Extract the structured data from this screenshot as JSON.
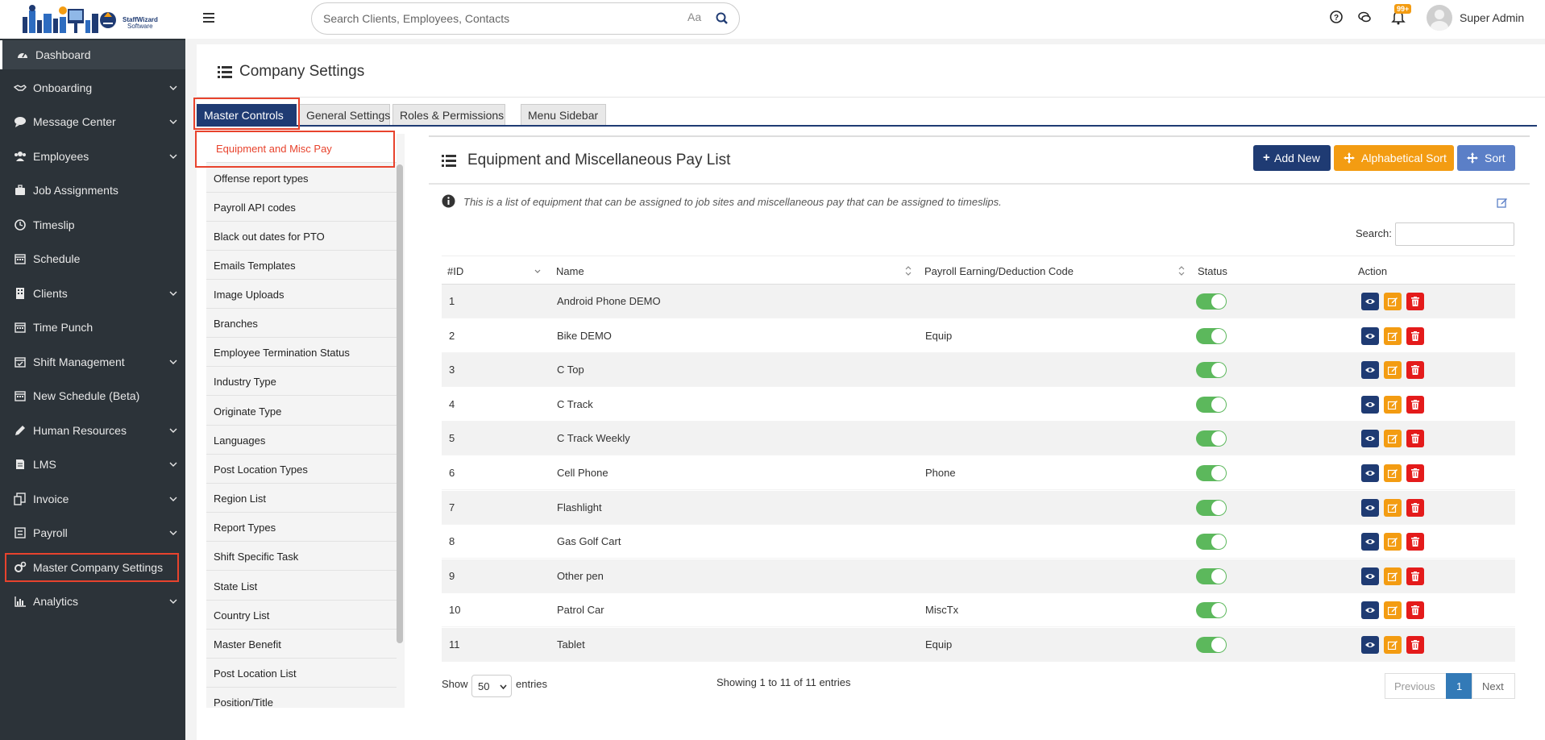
{
  "header": {
    "search_placeholder": "Search Clients, Employees, Contacts",
    "case_toggle": "Aa",
    "notification_count": "99+",
    "user_name": "Super Admin"
  },
  "sidebar": {
    "items": [
      {
        "label": "Dashboard",
        "icon": "dashboard-icon",
        "expandable": false
      },
      {
        "label": "Onboarding",
        "icon": "handshake-icon",
        "expandable": true
      },
      {
        "label": "Message Center",
        "icon": "chat-icon",
        "expandable": true
      },
      {
        "label": "Employees",
        "icon": "users-icon",
        "expandable": true
      },
      {
        "label": "Job Assignments",
        "icon": "briefcase-icon",
        "expandable": false
      },
      {
        "label": "Timeslip",
        "icon": "clock-icon",
        "expandable": false
      },
      {
        "label": "Schedule",
        "icon": "calendar-icon",
        "expandable": false
      },
      {
        "label": "Clients",
        "icon": "building-icon",
        "expandable": true
      },
      {
        "label": "Time Punch",
        "icon": "calendar-icon",
        "expandable": false
      },
      {
        "label": "Shift Management",
        "icon": "calendar-check-icon",
        "expandable": true
      },
      {
        "label": "New Schedule (Beta)",
        "icon": "calendar-icon",
        "expandable": false
      },
      {
        "label": "Human Resources",
        "icon": "pencil-icon",
        "expandable": true
      },
      {
        "label": "LMS",
        "icon": "book-icon",
        "expandable": true
      },
      {
        "label": "Invoice",
        "icon": "invoice-icon",
        "expandable": true
      },
      {
        "label": "Payroll",
        "icon": "payroll-icon",
        "expandable": true
      },
      {
        "label": "Master Company Settings",
        "icon": "cogs-icon",
        "expandable": false
      },
      {
        "label": "Analytics",
        "icon": "bar-chart-icon",
        "expandable": true
      }
    ]
  },
  "page": {
    "title": "Company Settings"
  },
  "tabs": [
    "Master Controls",
    "General Settings",
    "Roles & Permissions",
    "Menu Sidebar"
  ],
  "settings_list": [
    "Equipment and Misc Pay",
    "Offense report types",
    "Payroll API codes",
    "Black out dates for PTO",
    "Emails Templates",
    "Image Uploads",
    "Branches",
    "Employee Termination Status",
    "Industry Type",
    "Originate Type",
    "Languages",
    "Post Location Types",
    "Region List",
    "Report Types",
    "Shift Specific Task",
    "State List",
    "Country List",
    "Master Benefit",
    "Post Location List",
    "Position/Title"
  ],
  "section": {
    "title": "Equipment and Miscellaneous Pay List",
    "add_new": "Add New",
    "alpha_sort": "Alphabetical Sort",
    "sort": "Sort",
    "info": "This is a list of equipment that can be assigned to job sites and miscellaneous pay that can be assigned to timeslips.",
    "search_label": "Search:"
  },
  "table": {
    "columns": [
      "#ID",
      "Name",
      "Payroll Earning/Deduction Code",
      "Status",
      "Action"
    ],
    "rows": [
      {
        "id": "1",
        "name": "Android Phone DEMO",
        "code": "",
        "status": true
      },
      {
        "id": "2",
        "name": "Bike DEMO",
        "code": "Equip",
        "status": true
      },
      {
        "id": "3",
        "name": "C Top",
        "code": "",
        "status": true
      },
      {
        "id": "4",
        "name": "C Track",
        "code": "",
        "status": true
      },
      {
        "id": "5",
        "name": "C Track Weekly",
        "code": "",
        "status": true
      },
      {
        "id": "6",
        "name": "Cell Phone",
        "code": "Phone",
        "status": true
      },
      {
        "id": "7",
        "name": "Flashlight",
        "code": "",
        "status": true
      },
      {
        "id": "8",
        "name": "Gas Golf Cart",
        "code": "",
        "status": true
      },
      {
        "id": "9",
        "name": "Other pen",
        "code": "",
        "status": true
      },
      {
        "id": "10",
        "name": "Patrol Car",
        "code": "MiscTx",
        "status": true
      },
      {
        "id": "11",
        "name": "Tablet",
        "code": "Equip",
        "status": true
      }
    ]
  },
  "footer": {
    "show": "Show",
    "entries_value": "50",
    "entries": "entries",
    "showing": "Showing 1 to 11 of 11 entries",
    "previous": "Previous",
    "page": "1",
    "next": "Next"
  },
  "colors": {
    "sidebar_bg": "#2c3339",
    "primary": "#1f3b73",
    "warning": "#f39c12",
    "info": "#5b7fc7",
    "danger": "#e41b1b",
    "highlight": "#e8432d",
    "toggle_on": "#5cb85c"
  }
}
